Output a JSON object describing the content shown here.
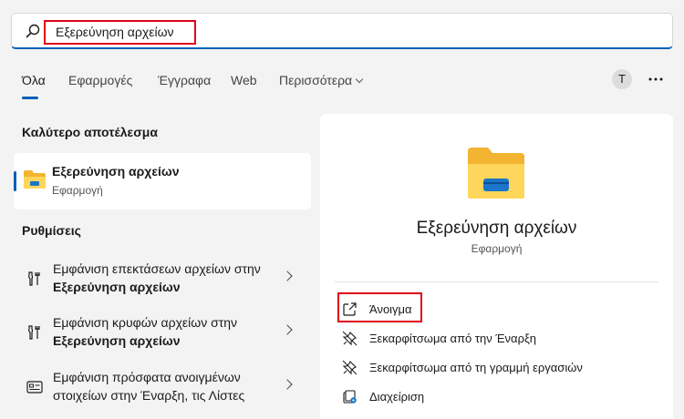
{
  "search": {
    "query": "Εξερεύνηση αρχείων",
    "icon": "search-icon"
  },
  "tabs": [
    {
      "label": "Όλα",
      "active": true
    },
    {
      "label": "Εφαρμογές",
      "active": false
    },
    {
      "label": "Έγγραφα",
      "active": false
    },
    {
      "label": "Web",
      "active": false
    },
    {
      "label": "Περισσότερα",
      "active": false
    }
  ],
  "header": {
    "avatar_letter": "T",
    "more_icon": "more-icon"
  },
  "best_match": {
    "section_title": "Καλύτερο αποτέλεσμα",
    "name": "Εξερεύνηση αρχείων",
    "type": "Εφαρμογή",
    "icon": "folder-icon"
  },
  "settings": {
    "section_title": "Ρυθμίσεις",
    "items": [
      {
        "text": "Εμφάνιση επεκτάσεων αρχείων στην ",
        "bold": "Εξερεύνηση αρχείων",
        "icon": "settings-tool-icon"
      },
      {
        "text": "Εμφάνιση κρυφών αρχείων στην ",
        "bold": "Εξερεύνηση αρχείων",
        "icon": "settings-tool-icon"
      },
      {
        "text": "Εμφάνιση πρόσφατα ανοιγμένων στοιχείων στην Έναρξη, τις Λίστες",
        "bold": "",
        "icon": "display-icon"
      }
    ]
  },
  "detail": {
    "title": "Εξερεύνηση αρχείων",
    "subtitle": "Εφαρμογή",
    "actions": [
      {
        "label": "Άνοιγμα",
        "icon": "open-external-icon"
      },
      {
        "label": "Ξεκαρφίτσωμα από την Έναρξη",
        "icon": "unpin-icon"
      },
      {
        "label": "Ξεκαρφίτσωμα από τη γραμμή εργασιών",
        "icon": "unpin-icon"
      },
      {
        "label": "Διαχείριση",
        "icon": "manage-icon"
      }
    ]
  },
  "colors": {
    "accent": "#005fb8",
    "highlight": "#e0001a",
    "folder": "#ffc83d"
  }
}
